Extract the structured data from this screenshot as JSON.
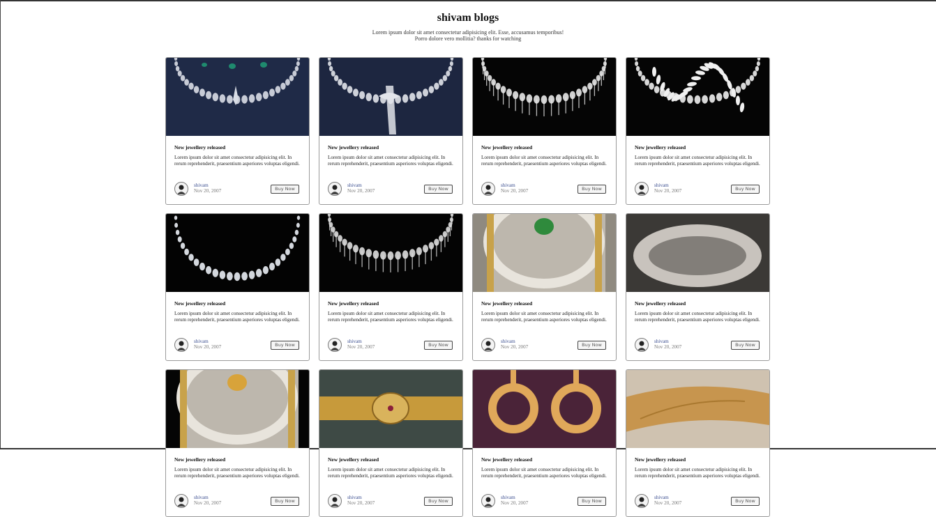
{
  "header": {
    "title": "shivam blogs",
    "subtitle_line1": "Lorem ipsum dolor sit amet consectetur adipisicing elit. Esse, accusamus temporibus!",
    "subtitle_line2": "Porro dolore vero mollitia? thanks for watching"
  },
  "card_common": {
    "title": "New jewellery released",
    "text": "Lorem ipsum dolor sit amet consectetur adipisicing elit. In rerum reprehenderit, praesentium asperiores voluptas eligendi.",
    "author": "shivam",
    "date": "Nov 20, 2007",
    "button": "Buy Now"
  },
  "cards": [
    {
      "image": "diamond-emerald-necklace-on-navy",
      "colors": [
        "#1f2a47",
        "#d9dde6"
      ]
    },
    {
      "image": "diamond-bow-necklace-on-navy",
      "colors": [
        "#1d2640",
        "#e2e4ea"
      ]
    },
    {
      "image": "diamond-collar-necklace-on-black",
      "colors": [
        "#050505",
        "#e8e8e8"
      ]
    },
    {
      "image": "diamond-leaf-necklace-on-black",
      "colors": [
        "#050505",
        "#f0f0f0"
      ]
    },
    {
      "image": "diamond-riviere-necklace-on-black",
      "colors": [
        "#030303",
        "#eaeef5"
      ]
    },
    {
      "image": "diamond-fringe-necklace-on-black",
      "colors": [
        "#040404",
        "#dddddd"
      ]
    },
    {
      "image": "emerald-diamond-bangle",
      "colors": [
        "#8f8a80",
        "#2f8a3c"
      ]
    },
    {
      "image": "diamond-cuff-bracelet",
      "colors": [
        "#3b3936",
        "#d8d3cc"
      ]
    },
    {
      "image": "gold-bangles-on-black",
      "colors": [
        "#050505",
        "#d8a33a"
      ]
    },
    {
      "image": "gold-waist-belt",
      "colors": [
        "#3e4a45",
        "#c79a3b"
      ]
    },
    {
      "image": "gold-earrings-on-plum",
      "colors": [
        "#4a2338",
        "#e0a85a"
      ]
    },
    {
      "image": "gold-engraved-ring",
      "colors": [
        "#cfc2b0",
        "#c7954e"
      ]
    }
  ],
  "colors": {
    "accent_author": "#3a4d8f",
    "border": "#9a9a9a"
  }
}
